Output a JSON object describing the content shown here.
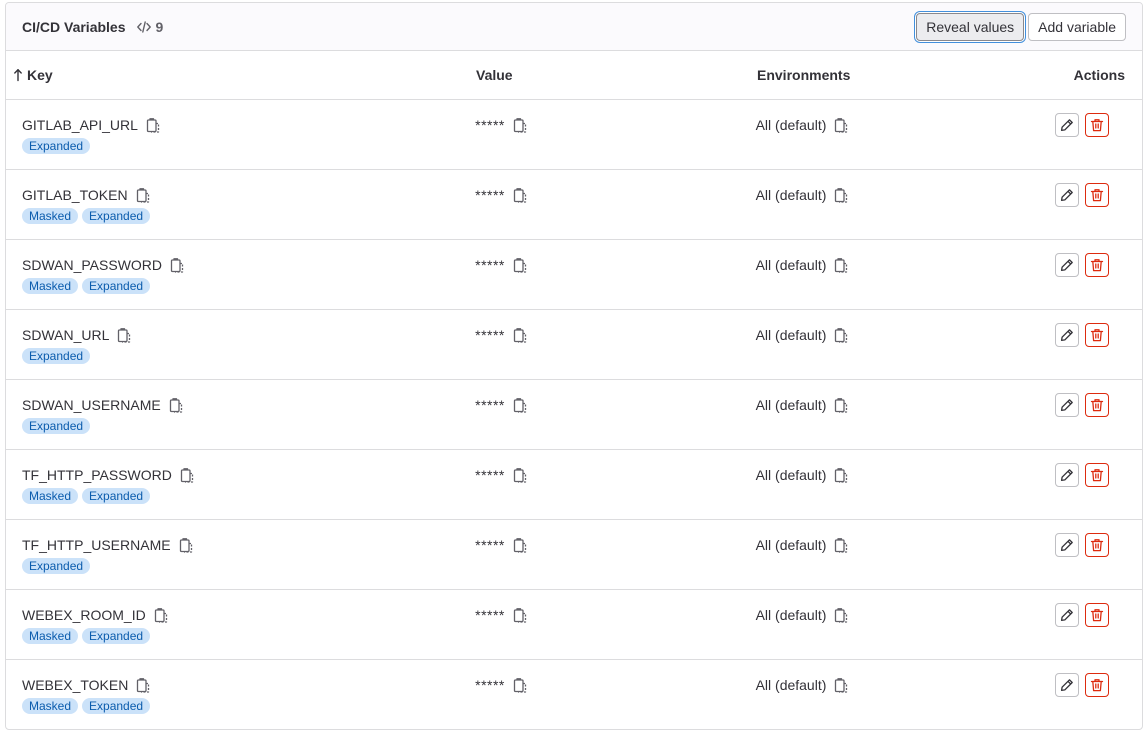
{
  "header": {
    "title": "CI/CD Variables",
    "count": "9",
    "reveal_label": "Reveal values",
    "add_label": "Add variable"
  },
  "columns": {
    "key": "Key",
    "value": "Value",
    "environments": "Environments",
    "actions": "Actions"
  },
  "variables": [
    {
      "key": "GITLAB_API_URL",
      "value": "*****",
      "env": "All (default)",
      "badges": [
        "Expanded"
      ]
    },
    {
      "key": "GITLAB_TOKEN",
      "value": "*****",
      "env": "All (default)",
      "badges": [
        "Masked",
        "Expanded"
      ]
    },
    {
      "key": "SDWAN_PASSWORD",
      "value": "*****",
      "env": "All (default)",
      "badges": [
        "Masked",
        "Expanded"
      ]
    },
    {
      "key": "SDWAN_URL",
      "value": "*****",
      "env": "All (default)",
      "badges": [
        "Expanded"
      ]
    },
    {
      "key": "SDWAN_USERNAME",
      "value": "*****",
      "env": "All (default)",
      "badges": [
        "Expanded"
      ]
    },
    {
      "key": "TF_HTTP_PASSWORD",
      "value": "*****",
      "env": "All (default)",
      "badges": [
        "Masked",
        "Expanded"
      ]
    },
    {
      "key": "TF_HTTP_USERNAME",
      "value": "*****",
      "env": "All (default)",
      "badges": [
        "Expanded"
      ]
    },
    {
      "key": "WEBEX_ROOM_ID",
      "value": "*****",
      "env": "All (default)",
      "badges": [
        "Masked",
        "Expanded"
      ]
    },
    {
      "key": "WEBEX_TOKEN",
      "value": "*****",
      "env": "All (default)",
      "badges": [
        "Masked",
        "Expanded"
      ]
    }
  ],
  "icons": {
    "count": "code-icon",
    "sort": "arrow-up-icon",
    "copy": "copy-to-clipboard-icon",
    "edit": "pencil-icon",
    "delete": "trash-icon"
  },
  "colors": {
    "badge_bg": "#cbe2f9",
    "badge_text": "#0b5cad",
    "danger": "#dd2b0e",
    "focus": "#428fdc"
  }
}
